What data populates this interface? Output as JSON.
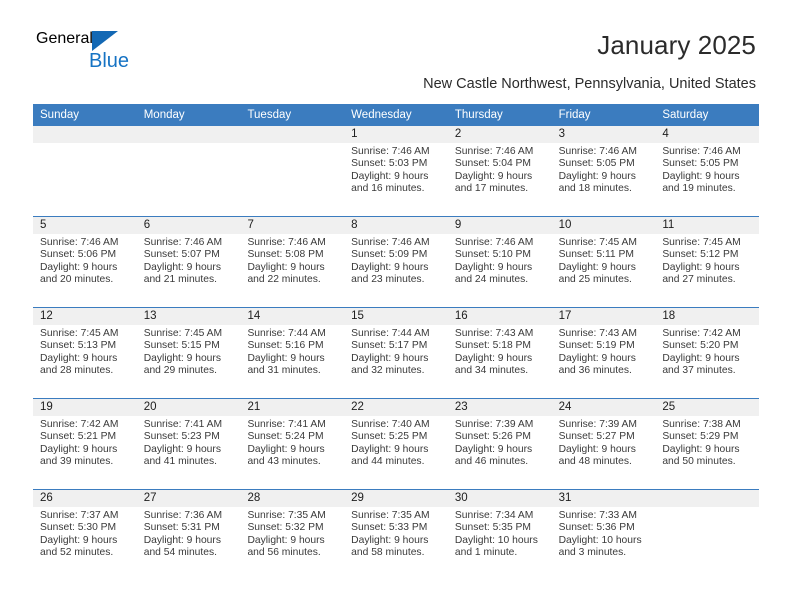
{
  "branding": {
    "logo_primary": "General",
    "logo_secondary": "Blue",
    "logo_accent_color": "#1368b4"
  },
  "header": {
    "title": "January 2025",
    "subtitle": "New Castle Northwest, Pennsylvania, United States"
  },
  "theme": {
    "header_row_color": "#3b7cbf",
    "date_strip_color": "#f0f0f0",
    "text_color": "#3a3a3a"
  },
  "calendar": {
    "weekday_headers": [
      "Sunday",
      "Monday",
      "Tuesday",
      "Wednesday",
      "Thursday",
      "Friday",
      "Saturday"
    ],
    "weeks": [
      [
        {
          "date": "",
          "sunrise": "",
          "sunset": "",
          "daylight_line1": "",
          "daylight_line2": ""
        },
        {
          "date": "",
          "sunrise": "",
          "sunset": "",
          "daylight_line1": "",
          "daylight_line2": ""
        },
        {
          "date": "",
          "sunrise": "",
          "sunset": "",
          "daylight_line1": "",
          "daylight_line2": ""
        },
        {
          "date": "1",
          "sunrise": "Sunrise: 7:46 AM",
          "sunset": "Sunset: 5:03 PM",
          "daylight_line1": "Daylight: 9 hours",
          "daylight_line2": "and 16 minutes."
        },
        {
          "date": "2",
          "sunrise": "Sunrise: 7:46 AM",
          "sunset": "Sunset: 5:04 PM",
          "daylight_line1": "Daylight: 9 hours",
          "daylight_line2": "and 17 minutes."
        },
        {
          "date": "3",
          "sunrise": "Sunrise: 7:46 AM",
          "sunset": "Sunset: 5:05 PM",
          "daylight_line1": "Daylight: 9 hours",
          "daylight_line2": "and 18 minutes."
        },
        {
          "date": "4",
          "sunrise": "Sunrise: 7:46 AM",
          "sunset": "Sunset: 5:05 PM",
          "daylight_line1": "Daylight: 9 hours",
          "daylight_line2": "and 19 minutes."
        }
      ],
      [
        {
          "date": "5",
          "sunrise": "Sunrise: 7:46 AM",
          "sunset": "Sunset: 5:06 PM",
          "daylight_line1": "Daylight: 9 hours",
          "daylight_line2": "and 20 minutes."
        },
        {
          "date": "6",
          "sunrise": "Sunrise: 7:46 AM",
          "sunset": "Sunset: 5:07 PM",
          "daylight_line1": "Daylight: 9 hours",
          "daylight_line2": "and 21 minutes."
        },
        {
          "date": "7",
          "sunrise": "Sunrise: 7:46 AM",
          "sunset": "Sunset: 5:08 PM",
          "daylight_line1": "Daylight: 9 hours",
          "daylight_line2": "and 22 minutes."
        },
        {
          "date": "8",
          "sunrise": "Sunrise: 7:46 AM",
          "sunset": "Sunset: 5:09 PM",
          "daylight_line1": "Daylight: 9 hours",
          "daylight_line2": "and 23 minutes."
        },
        {
          "date": "9",
          "sunrise": "Sunrise: 7:46 AM",
          "sunset": "Sunset: 5:10 PM",
          "daylight_line1": "Daylight: 9 hours",
          "daylight_line2": "and 24 minutes."
        },
        {
          "date": "10",
          "sunrise": "Sunrise: 7:45 AM",
          "sunset": "Sunset: 5:11 PM",
          "daylight_line1": "Daylight: 9 hours",
          "daylight_line2": "and 25 minutes."
        },
        {
          "date": "11",
          "sunrise": "Sunrise: 7:45 AM",
          "sunset": "Sunset: 5:12 PM",
          "daylight_line1": "Daylight: 9 hours",
          "daylight_line2": "and 27 minutes."
        }
      ],
      [
        {
          "date": "12",
          "sunrise": "Sunrise: 7:45 AM",
          "sunset": "Sunset: 5:13 PM",
          "daylight_line1": "Daylight: 9 hours",
          "daylight_line2": "and 28 minutes."
        },
        {
          "date": "13",
          "sunrise": "Sunrise: 7:45 AM",
          "sunset": "Sunset: 5:15 PM",
          "daylight_line1": "Daylight: 9 hours",
          "daylight_line2": "and 29 minutes."
        },
        {
          "date": "14",
          "sunrise": "Sunrise: 7:44 AM",
          "sunset": "Sunset: 5:16 PM",
          "daylight_line1": "Daylight: 9 hours",
          "daylight_line2": "and 31 minutes."
        },
        {
          "date": "15",
          "sunrise": "Sunrise: 7:44 AM",
          "sunset": "Sunset: 5:17 PM",
          "daylight_line1": "Daylight: 9 hours",
          "daylight_line2": "and 32 minutes."
        },
        {
          "date": "16",
          "sunrise": "Sunrise: 7:43 AM",
          "sunset": "Sunset: 5:18 PM",
          "daylight_line1": "Daylight: 9 hours",
          "daylight_line2": "and 34 minutes."
        },
        {
          "date": "17",
          "sunrise": "Sunrise: 7:43 AM",
          "sunset": "Sunset: 5:19 PM",
          "daylight_line1": "Daylight: 9 hours",
          "daylight_line2": "and 36 minutes."
        },
        {
          "date": "18",
          "sunrise": "Sunrise: 7:42 AM",
          "sunset": "Sunset: 5:20 PM",
          "daylight_line1": "Daylight: 9 hours",
          "daylight_line2": "and 37 minutes."
        }
      ],
      [
        {
          "date": "19",
          "sunrise": "Sunrise: 7:42 AM",
          "sunset": "Sunset: 5:21 PM",
          "daylight_line1": "Daylight: 9 hours",
          "daylight_line2": "and 39 minutes."
        },
        {
          "date": "20",
          "sunrise": "Sunrise: 7:41 AM",
          "sunset": "Sunset: 5:23 PM",
          "daylight_line1": "Daylight: 9 hours",
          "daylight_line2": "and 41 minutes."
        },
        {
          "date": "21",
          "sunrise": "Sunrise: 7:41 AM",
          "sunset": "Sunset: 5:24 PM",
          "daylight_line1": "Daylight: 9 hours",
          "daylight_line2": "and 43 minutes."
        },
        {
          "date": "22",
          "sunrise": "Sunrise: 7:40 AM",
          "sunset": "Sunset: 5:25 PM",
          "daylight_line1": "Daylight: 9 hours",
          "daylight_line2": "and 44 minutes."
        },
        {
          "date": "23",
          "sunrise": "Sunrise: 7:39 AM",
          "sunset": "Sunset: 5:26 PM",
          "daylight_line1": "Daylight: 9 hours",
          "daylight_line2": "and 46 minutes."
        },
        {
          "date": "24",
          "sunrise": "Sunrise: 7:39 AM",
          "sunset": "Sunset: 5:27 PM",
          "daylight_line1": "Daylight: 9 hours",
          "daylight_line2": "and 48 minutes."
        },
        {
          "date": "25",
          "sunrise": "Sunrise: 7:38 AM",
          "sunset": "Sunset: 5:29 PM",
          "daylight_line1": "Daylight: 9 hours",
          "daylight_line2": "and 50 minutes."
        }
      ],
      [
        {
          "date": "26",
          "sunrise": "Sunrise: 7:37 AM",
          "sunset": "Sunset: 5:30 PM",
          "daylight_line1": "Daylight: 9 hours",
          "daylight_line2": "and 52 minutes."
        },
        {
          "date": "27",
          "sunrise": "Sunrise: 7:36 AM",
          "sunset": "Sunset: 5:31 PM",
          "daylight_line1": "Daylight: 9 hours",
          "daylight_line2": "and 54 minutes."
        },
        {
          "date": "28",
          "sunrise": "Sunrise: 7:35 AM",
          "sunset": "Sunset: 5:32 PM",
          "daylight_line1": "Daylight: 9 hours",
          "daylight_line2": "and 56 minutes."
        },
        {
          "date": "29",
          "sunrise": "Sunrise: 7:35 AM",
          "sunset": "Sunset: 5:33 PM",
          "daylight_line1": "Daylight: 9 hours",
          "daylight_line2": "and 58 minutes."
        },
        {
          "date": "30",
          "sunrise": "Sunrise: 7:34 AM",
          "sunset": "Sunset: 5:35 PM",
          "daylight_line1": "Daylight: 10 hours",
          "daylight_line2": "and 1 minute."
        },
        {
          "date": "31",
          "sunrise": "Sunrise: 7:33 AM",
          "sunset": "Sunset: 5:36 PM",
          "daylight_line1": "Daylight: 10 hours",
          "daylight_line2": "and 3 minutes."
        }
      ]
    ]
  }
}
